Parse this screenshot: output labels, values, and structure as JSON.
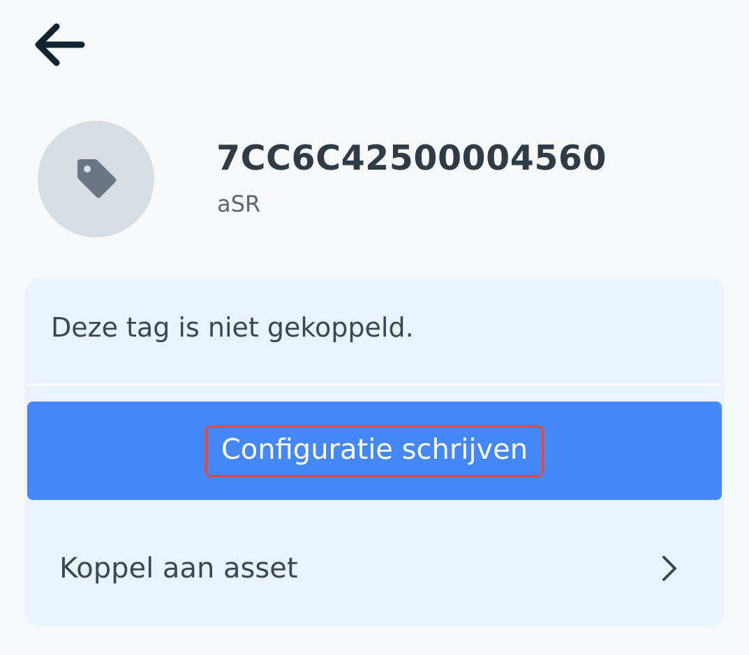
{
  "header": {
    "back_icon": "arrow-left-icon"
  },
  "tag": {
    "icon": "tag-icon",
    "id": "7CC6C42500004560",
    "owner": "aSR"
  },
  "card": {
    "status_text": "Deze tag is niet gekoppeld.",
    "primary_button_label": "Configuratie schrijven",
    "link_label": "Koppel aan asset",
    "link_icon": "chevron-right-icon"
  },
  "colors": {
    "background": "#f7f8fa",
    "card_background": "#eaf2fd",
    "primary": "#4388f6",
    "highlight_border": "#e8463a",
    "text_dark": "#2f3b45",
    "avatar_background": "#d8dde3"
  }
}
